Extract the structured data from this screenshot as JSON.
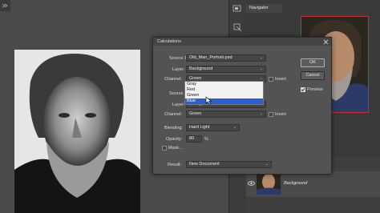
{
  "navigator": {
    "tab_label": "Navigator"
  },
  "layers": {
    "layer_name": "Background"
  },
  "dialog": {
    "title": "Calculations",
    "source1": {
      "label": "Source 1:",
      "value": "Old_Man_Portrait.psd",
      "layer_label": "Layer:",
      "layer_value": "Background",
      "channel_label": "Channel:",
      "channel_value": "Green",
      "invert_label": "Invert",
      "invert_checked": false
    },
    "channel_options": [
      "Gray",
      "Red",
      "Green",
      "Blue"
    ],
    "channel_highlighted": "Blue",
    "source2": {
      "label": "Source 2:",
      "layer_label": "Layer:",
      "layer_value": "Background",
      "channel_label": "Channel:",
      "channel_value": "Green",
      "invert_label": "Invert",
      "invert_checked": false
    },
    "blending": {
      "label": "Blending:",
      "value": "Hard Light"
    },
    "opacity": {
      "label": "Opacity:",
      "value": "80",
      "unit": "%"
    },
    "mask": {
      "label": "Mask...",
      "checked": false
    },
    "result": {
      "label": "Result:",
      "value": "New Document"
    },
    "ok_label": "OK",
    "cancel_label": "Cancel",
    "preview_label": "Preview",
    "preview_checked": true
  }
}
